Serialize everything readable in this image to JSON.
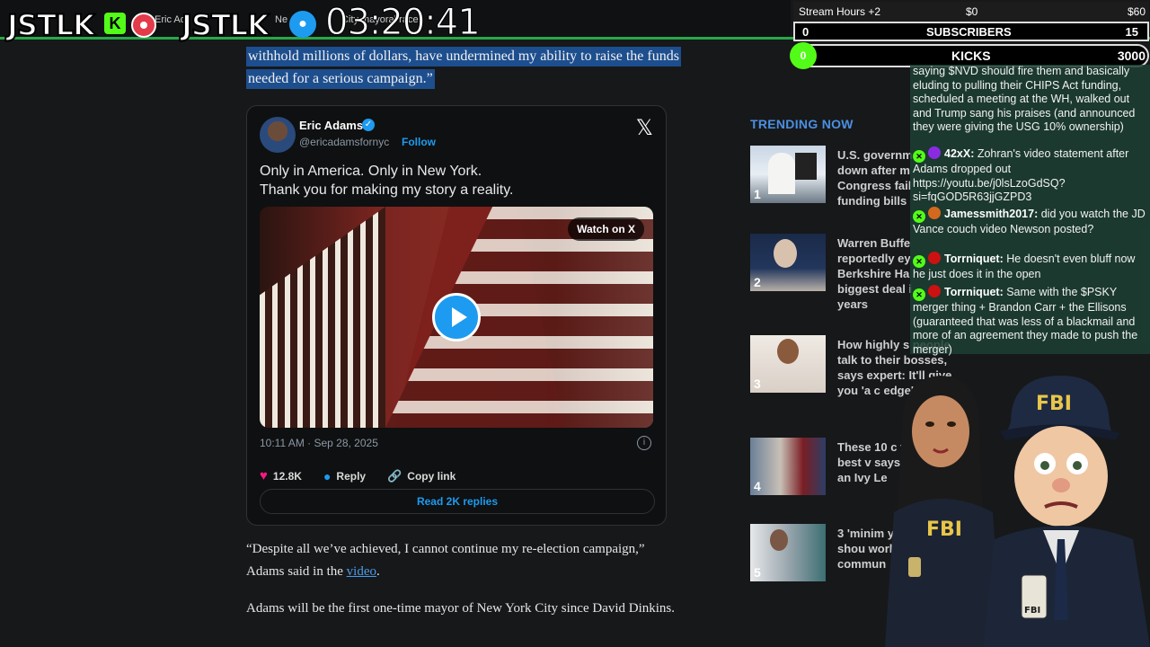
{
  "stream": {
    "logo_left": "JSTLK",
    "kick_letter": "K",
    "logo_right": "JSTLK",
    "timer": "03:20:41",
    "tab_snippet_1": "Eric Ad",
    "tab_snippet_2": "Ne",
    "tab_snippet_3": "City mayoral race"
  },
  "hud": {
    "stream_hours": "Stream Hours +2",
    "money_min": "$0",
    "money_max": "$60",
    "subs_count": "0",
    "subs_label": "SUBSCRIBERS",
    "subs_goal": "15",
    "kicks_count": "0",
    "kicks_label": "KICKS",
    "kicks_goal": "3000"
  },
  "article": {
    "highlight_line1": "withhold millions of dollars, have undermined my ability to raise the funds",
    "highlight_line2": "needed for a serious campaign.”",
    "para1_line1": "“Despite all we’ve achieved, I cannot continue my re-election campaign,”",
    "para1_line2_pre": "Adams said in the ",
    "para1_link": "video",
    "para1_line2_post": ".",
    "para2": "Adams will be the first one-time mayor of New York City since David Dinkins."
  },
  "tweet": {
    "name": "Eric Adams",
    "handle": "@ericadamsfornyc",
    "follow": "Follow",
    "line1": "Only in America. Only in New York.",
    "line2": "Thank you for making my story a reality.",
    "watch_on_x": "Watch on X",
    "timestamp": "10:11 AM · Sep 28, 2025",
    "likes": "12.8K",
    "reply": "Reply",
    "copy_link": "Copy link",
    "read_replies": "Read 2K replies"
  },
  "trending": {
    "title": "TRENDING NOW",
    "items": [
      {
        "num": "1",
        "text": "U.S. governm down after m Congress fail funding bills"
      },
      {
        "num": "2",
        "text": "Warren Buffe reportedly ey Berkshire Ha biggest deal i years"
      },
      {
        "num": "3",
        "text": "How highly s people talk to their bosses, says expert: It'll give you 'a c edge'"
      },
      {
        "num": "4",
        "text": "These 10 c the best v says new an Ivy Le"
      },
      {
        "num": "5",
        "text": "3 'minim you shou work, fro commun"
      }
    ]
  },
  "chat": {
    "messages": [
      {
        "user": "",
        "text": "saying $NVD should fire them and basically eluding to pulling their CHIPS Act funding, scheduled a meeting at the WH, walked out and Trump sang his praises (and announced they were giving the USG 10% ownership)"
      },
      {
        "user": "42xX:",
        "text": "Zohran's video statement after Adams dropped out https://youtu.be/j0lsLzoGdSQ?si=fqGOD5R63jjGZPD3",
        "color": "#8a2be2"
      },
      {
        "user": "Jamessmith2017:",
        "text": "did you watch the JD Vance couch video Newson posted?",
        "color": "#d2691e"
      },
      {
        "user": "Torrniquet:",
        "text": "He doesn't even bluff now he just does it in the open",
        "color": "#cc1111"
      },
      {
        "user": "Torrniquet:",
        "text": "Same with the $PSKY merger thing + Brandon Carr + the Ellisons (guaranteed that was less of a blackmail and more of an agreement they made to push the merger)",
        "color": "#cc1111"
      }
    ]
  },
  "overlay": {
    "fbi_cap": "FBI",
    "fbi_jacket_left": "FBI",
    "fbi_badge": "FBI"
  }
}
